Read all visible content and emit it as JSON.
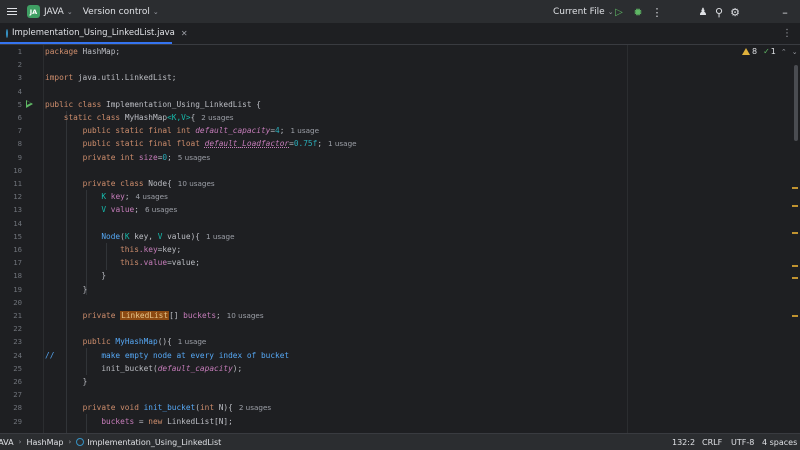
{
  "titlebar": {
    "project_badge": "JA",
    "project_name": "JAVA",
    "version_control": "Version control",
    "run_config": "Current File",
    "icons": [
      "menu-icon",
      "run-icon",
      "debug-icon",
      "more-icon",
      "add-user-icon",
      "search-icon",
      "settings-icon",
      "minimize-icon"
    ]
  },
  "tabs": [
    {
      "label": "Implementation_Using_LinkedList.java",
      "active": true
    }
  ],
  "inspections": {
    "warnings": "8",
    "ok": "1"
  },
  "editor": {
    "lines": [
      {
        "n": "1"
      },
      {
        "n": "2"
      },
      {
        "n": "3"
      },
      {
        "n": "4"
      },
      {
        "n": "5"
      },
      {
        "n": "6"
      },
      {
        "n": "7"
      },
      {
        "n": "8"
      },
      {
        "n": "9"
      },
      {
        "n": "10"
      },
      {
        "n": "11"
      },
      {
        "n": "12"
      },
      {
        "n": "13"
      },
      {
        "n": "14"
      },
      {
        "n": "15"
      },
      {
        "n": "16"
      },
      {
        "n": "17"
      },
      {
        "n": "18"
      },
      {
        "n": "19"
      },
      {
        "n": "20"
      },
      {
        "n": "21"
      },
      {
        "n": "22"
      },
      {
        "n": "23"
      },
      {
        "n": "24"
      },
      {
        "n": "25"
      },
      {
        "n": "26"
      },
      {
        "n": "27"
      },
      {
        "n": "28"
      },
      {
        "n": "29"
      }
    ],
    "tokens": {
      "l1_kw": "package",
      "l1_rest": " HashMap;",
      "l3_kw": "import",
      "l3_rest": " java.util.LinkedList;",
      "l5_kw": "public class",
      "l5_rest": " Implementation_Using_LinkedList {",
      "l6_kw": "static class",
      "l6_cls": " MyHashMap",
      "l6_tp": "<K,V>",
      "l6_rest": "{",
      "l6_inlay": "2 usages",
      "l7_kw": "public static final int",
      "l7_fld": "default_capacity",
      "l7_eq": "=",
      "l7_num": "4",
      "l7_end": ";",
      "l7_inlay": "1 usage",
      "l8_kw": "public static final float",
      "l8_fld": "default_Loadfactor",
      "l8_eq": "=",
      "l8_num": "0.75f",
      "l8_end": ";",
      "l8_inlay": "1 usage",
      "l9_kw": "private int",
      "l9_fld": "size",
      "l9_eq": "=",
      "l9_num": "0",
      "l9_end": ";",
      "l9_inlay": "5 usages",
      "l11_kw": "private class",
      "l11_rest": " Node{",
      "l11_inlay": "10 usages",
      "l12_tp": "K",
      "l12_fld": "key",
      "l12_end": ";",
      "l12_inlay": "4 usages",
      "l13_tp": "V",
      "l13_fld": "value",
      "l13_end": ";",
      "l13_inlay": "6 usages",
      "l15_fn": "Node",
      "l15_p1": "(",
      "l15_tp1": "K",
      "l15_p2": " key, ",
      "l15_tp2": "V",
      "l15_p3": " value){",
      "l15_inlay": "1 usage",
      "l16_kw": "this",
      "l16_fld": ".key",
      "l16_rest": "=key;",
      "l17_kw": "this",
      "l17_fld": ".value",
      "l17_rest": "=value;",
      "l18": "}",
      "l19": "}",
      "l21_kw": "private",
      "l21_hl": "LinkedList",
      "l21_mid": "[] ",
      "l21_fld": "buckets",
      "l21_end": ";",
      "l21_inlay": "10 usages",
      "l23_kw": "public",
      "l23_fn": " MyHashMap",
      "l23_rest": "(){",
      "l23_inlay": "1 usage",
      "l24_cm1": "//",
      "l24_cm2": "make empty node at every index of bucket",
      "l25_rest": "init_bucket(",
      "l25_fld": "default_capacity",
      "l25_end": ");",
      "l26": "}",
      "l28_kw": "private void",
      "l28_fn": " init_bucket",
      "l28_p1": "(",
      "l28_kw2": "int",
      "l28_p2": " N){",
      "l28_inlay": "2 usages",
      "l29_fld": "buckets",
      "l29_eq": " = ",
      "l29_kw": "new",
      "l29_rest": " LinkedList[N];"
    }
  },
  "statusbar": {
    "breadcrumbs": [
      "JAVA",
      "HashMap",
      "Implementation_Using_LinkedList"
    ],
    "position": "132:2",
    "line_sep": "CRLF",
    "encoding": "UTF-8",
    "indent": "4 spaces"
  },
  "colors": {
    "background": "#1e1f22",
    "keyword": "#cf8e6d",
    "field": "#c77dbb",
    "number": "#2aacb8",
    "method": "#56a8f5",
    "type_param": "#16baac",
    "highlight": "#8c4a12",
    "accent": "#3574f0"
  }
}
